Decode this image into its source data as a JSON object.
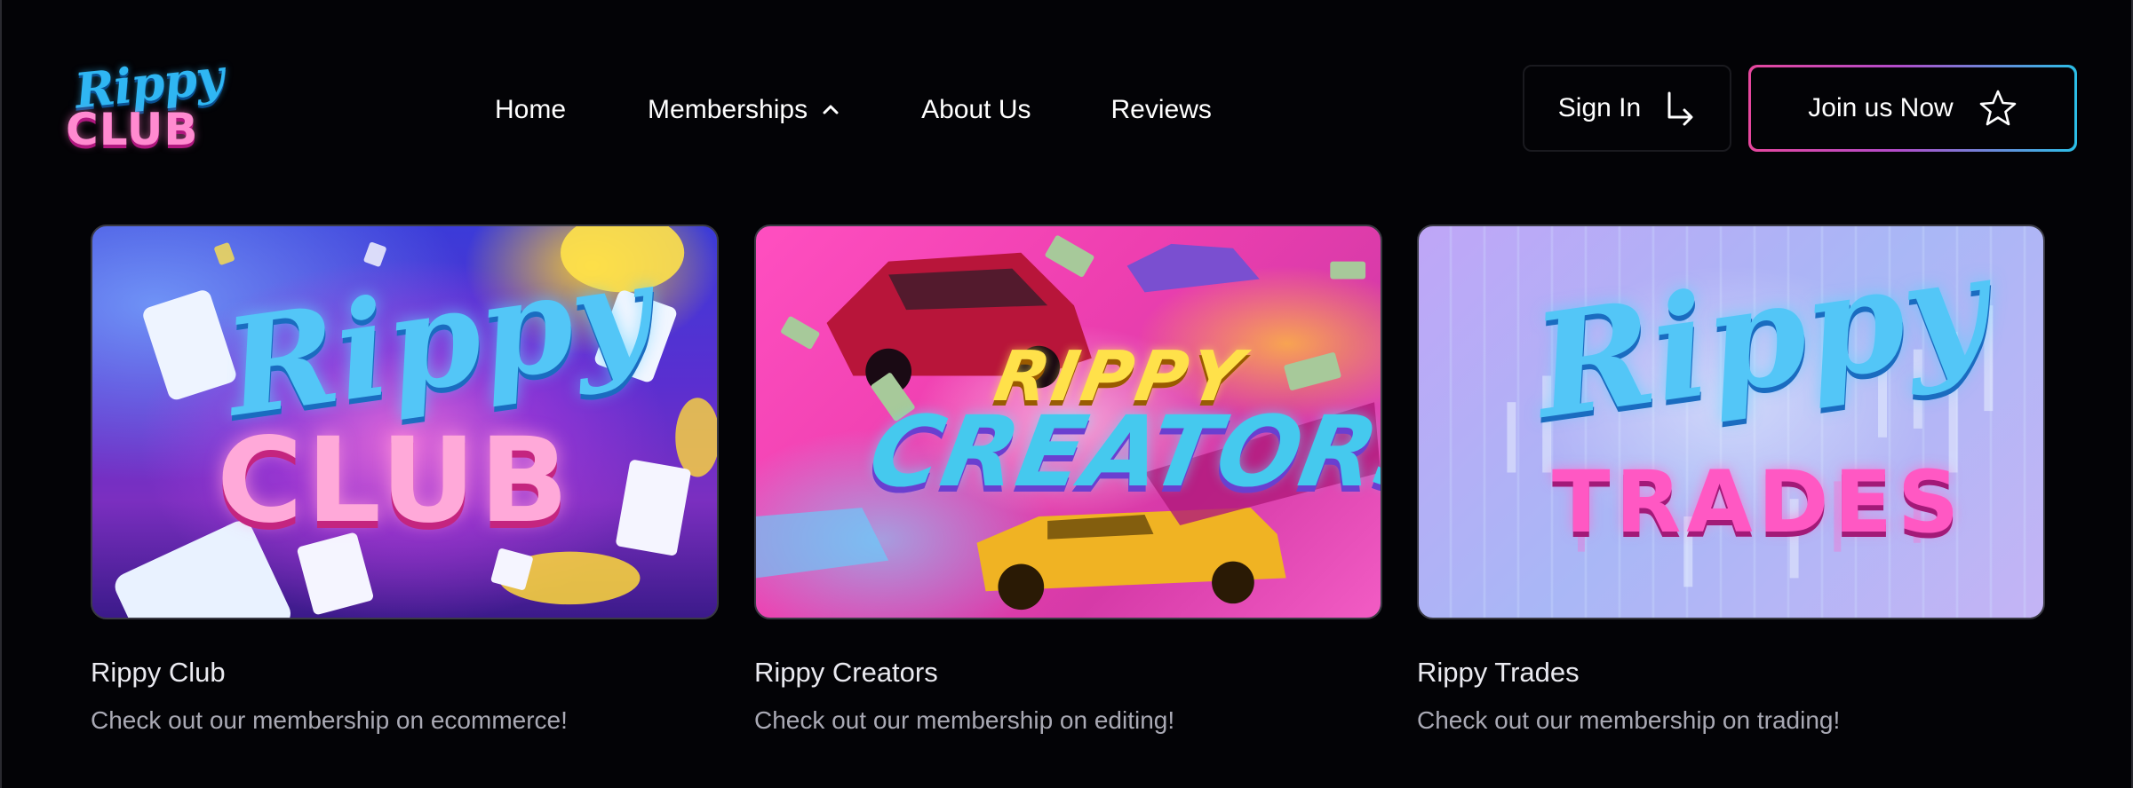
{
  "brand": {
    "logo_top": "Rippy",
    "logo_bottom": "CLUB"
  },
  "nav": {
    "home": "Home",
    "memberships": "Memberships",
    "about": "About Us",
    "reviews": "Reviews"
  },
  "actions": {
    "sign_in": "Sign In",
    "join": "Join us Now"
  },
  "cards": [
    {
      "art_top": "Rippy",
      "art_bottom": "CLUB",
      "title": "Rippy Club",
      "description": "Check out our membership on ecommerce!"
    },
    {
      "art_top": "RIPPY",
      "art_bottom": "CREATORS",
      "title": "Rippy Creators",
      "description": "Check out our membership on editing!"
    },
    {
      "art_top": "Rippy",
      "art_bottom": "TRADES",
      "title": "Rippy Trades",
      "description": "Check out our membership on trading!"
    }
  ],
  "colors": {
    "background": "#030306",
    "join_border_start": "#e6479d",
    "join_border_end": "#2bbfe7",
    "text_primary": "#ffffff",
    "text_muted": "#a9a9b4"
  },
  "icons": {
    "memberships_chevron": "chevron-up-icon",
    "sign_in": "arrow-turn-down-right-icon",
    "join": "star-outline-icon"
  }
}
